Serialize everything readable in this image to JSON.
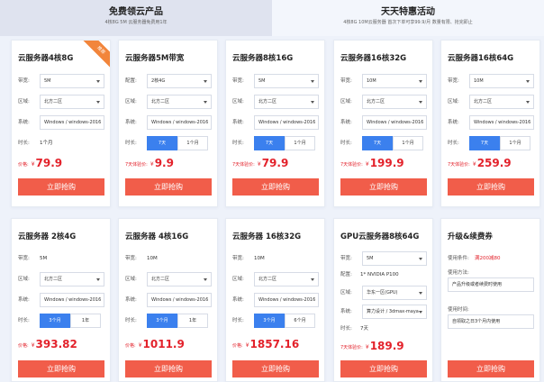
{
  "tabs": {
    "free": {
      "title": "免费领云产品",
      "subtitle": "4核8G 5M 云服务器免费用1年"
    },
    "daily": {
      "title": "天天特惠活动",
      "subtitle": "4核8G 10M云服务器 首次下单可享99.9/月 数量有限、抢完即止"
    }
  },
  "labels": {
    "bandwidth": "带宽:",
    "config": "配置:",
    "region": "区域:",
    "system": "系统:",
    "duration": "时长:",
    "price": "价格:",
    "trial_price": "7天体验价:",
    "currency": "¥",
    "buy": "立即抢购",
    "hot": "推荐"
  },
  "cards": [
    {
      "title": "云服务器4核8G",
      "bandwidth": "5M",
      "region": "北方二区",
      "system": "Windows / windows-2016",
      "duration": "1个月",
      "price": "79.9"
    },
    {
      "title": "云服务器5M带宽",
      "config": "2核4G",
      "region": "北方二区",
      "system": "Windows / windows-2016",
      "opt1": "7天",
      "opt2": "1个月",
      "price": "9.9"
    },
    {
      "title": "云服务器8核16G",
      "bandwidth": "5M",
      "region": "北方二区",
      "system": "Windows / windows-2016",
      "opt1": "7天",
      "opt2": "1个月",
      "price": "79.9"
    },
    {
      "title": "云服务器16核32G",
      "bandwidth": "10M",
      "region": "北方二区",
      "system": "Windows / windows-2016",
      "opt1": "7天",
      "opt2": "1个月",
      "price": "199.9"
    },
    {
      "title": "云服务器16核64G",
      "bandwidth": "10M",
      "region": "北方二区",
      "system": "Windows / windows-2016",
      "opt1": "7天",
      "opt2": "1个月",
      "price": "259.9"
    },
    {
      "title": "云服务器 2核4G",
      "bandwidth": "5M",
      "region": "北方二区",
      "system": "Windows / windows-2016",
      "opt1": "3个月",
      "opt2": "1年",
      "price": "393.82"
    },
    {
      "title": "云服务器 4核16G",
      "bandwidth": "10M",
      "region": "北方二区",
      "system": "Windows / windows-2016",
      "opt1": "3个月",
      "opt2": "1年",
      "price": "1011.9"
    },
    {
      "title": "云服务器 16核32G",
      "bandwidth": "10M",
      "region": "北方二区",
      "system": "Windows / windows-2016",
      "opt1": "3个月",
      "opt2": "6个月",
      "price": "1857.16"
    },
    {
      "title": "GPU云服务器8核64G",
      "bandwidth": "5M",
      "config": "1* NVIDIA P100",
      "region": "华东一区(GPU)",
      "system": "算力设计 / 3dmax-maya",
      "duration": "7天",
      "price": "189.9"
    },
    {
      "title": "升级&续费券",
      "condition_label": "使用条件:",
      "condition": "满200减80",
      "method_label": "使用方法:",
      "method": "产品升级或者续费时使用",
      "time_label": "使用时间:",
      "time": "自领取之日3个月内使用"
    }
  ]
}
